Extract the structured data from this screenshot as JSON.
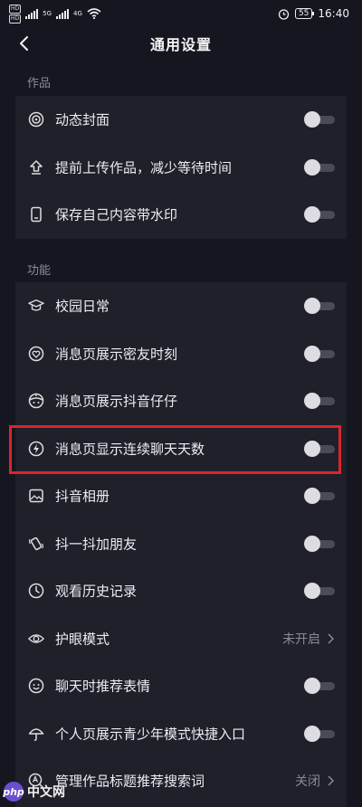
{
  "status_bar": {
    "hd1": "HD",
    "hd2": "HD",
    "net1": "5G",
    "net2": "4G",
    "battery": "55",
    "time": "16:40"
  },
  "header": {
    "title": "通用设置"
  },
  "sections": [
    {
      "title": "作品",
      "items": [
        {
          "label": "动态封面",
          "icon": "target-icon",
          "control": "toggle",
          "on": false
        },
        {
          "label": "提前上传作品，减少等待时间",
          "icon": "upload-icon",
          "control": "toggle",
          "on": false
        },
        {
          "label": "保存自己内容带水印",
          "icon": "phone-icon",
          "control": "toggle",
          "on": false
        }
      ]
    },
    {
      "title": "功能",
      "items": [
        {
          "label": "校园日常",
          "icon": "graduation-cap-icon",
          "control": "toggle",
          "on": false
        },
        {
          "label": "消息页展示密友时刻",
          "icon": "heart-badge-icon",
          "control": "toggle",
          "on": false
        },
        {
          "label": "消息页展示抖音仔仔",
          "icon": "avatar-face-icon",
          "control": "toggle",
          "on": false
        },
        {
          "label": "消息页显示连续聊天天数",
          "icon": "lightning-icon",
          "control": "toggle",
          "on": false
        },
        {
          "label": "抖音相册",
          "icon": "album-icon",
          "control": "toggle",
          "on": false
        },
        {
          "label": "抖一抖加朋友",
          "icon": "shake-phone-icon",
          "control": "toggle",
          "on": false
        },
        {
          "label": "观看历史记录",
          "icon": "clock-icon",
          "control": "toggle",
          "on": false
        },
        {
          "label": "护眼模式",
          "icon": "eye-icon",
          "control": "value",
          "value": "未开启"
        },
        {
          "label": "聊天时推荐表情",
          "icon": "emoji-icon",
          "control": "toggle",
          "on": false
        },
        {
          "label": "个人页展示青少年模式快捷入口",
          "icon": "umbrella-icon",
          "control": "toggle",
          "on": false
        },
        {
          "label": "管理作品标题推荐搜索词",
          "icon": "search-letter-icon",
          "control": "value",
          "value": "关闭"
        }
      ]
    }
  ],
  "watermark": {
    "logo": "php",
    "text": "中文网"
  }
}
